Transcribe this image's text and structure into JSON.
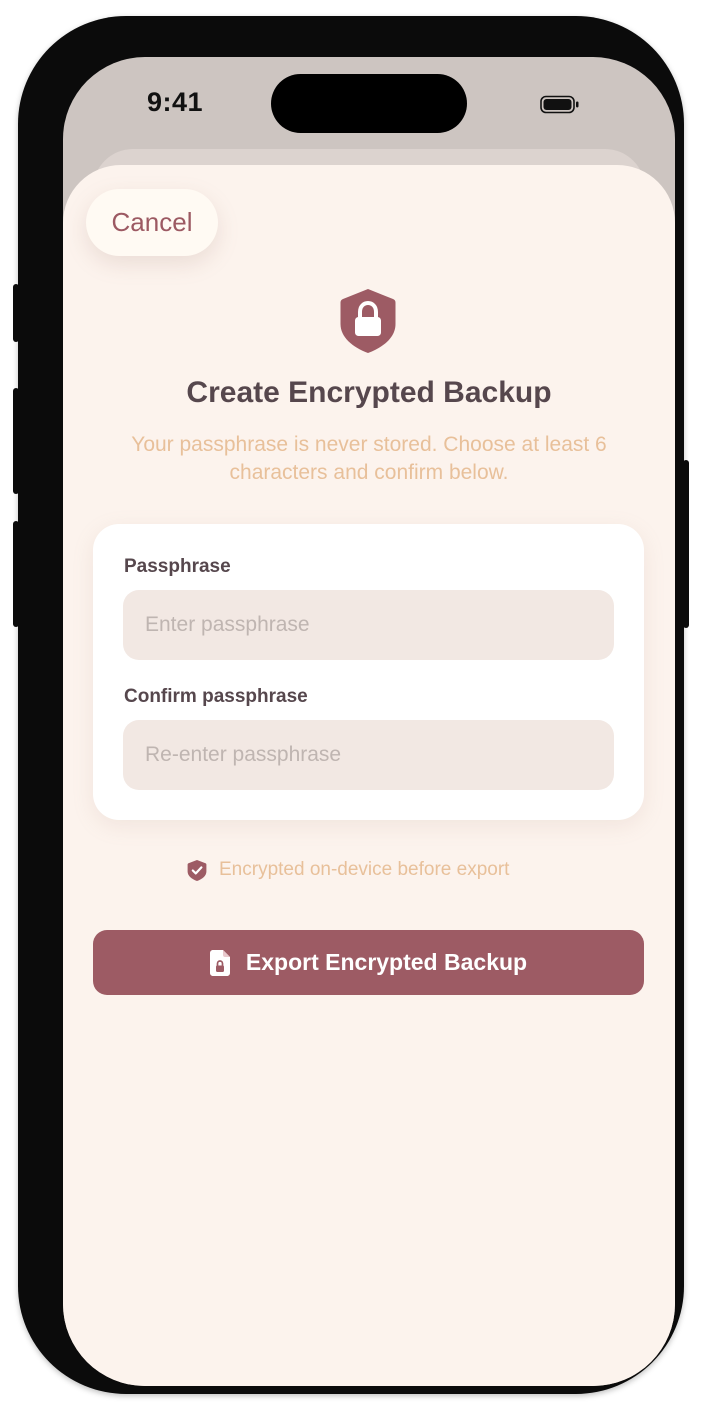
{
  "status_bar": {
    "time": "9:41"
  },
  "sheet": {
    "cancel_label": "Cancel",
    "title": "Create Encrypted Backup",
    "subtitle": "Your passphrase is never stored. Choose at least 6 characters and confirm below.",
    "form": {
      "passphrase_label": "Passphrase",
      "passphrase_value": "",
      "passphrase_placeholder": "Enter passphrase",
      "confirm_label": "Confirm passphrase",
      "confirm_value": "",
      "confirm_placeholder": "Re-enter passphrase"
    },
    "note": "Encrypted on-device before export",
    "export_label": "Export Encrypted Backup"
  },
  "icons": {
    "header": "shield-lock-icon",
    "note": "shield-check-icon",
    "export": "locked-document-icon",
    "battery": "battery-icon"
  },
  "colors": {
    "accent": "#9d5b64",
    "sheet_background": "#fcf3ed",
    "subtitle_text": "#e8c09a",
    "heading_text": "#56474d",
    "input_background": "#f2e8e3"
  }
}
